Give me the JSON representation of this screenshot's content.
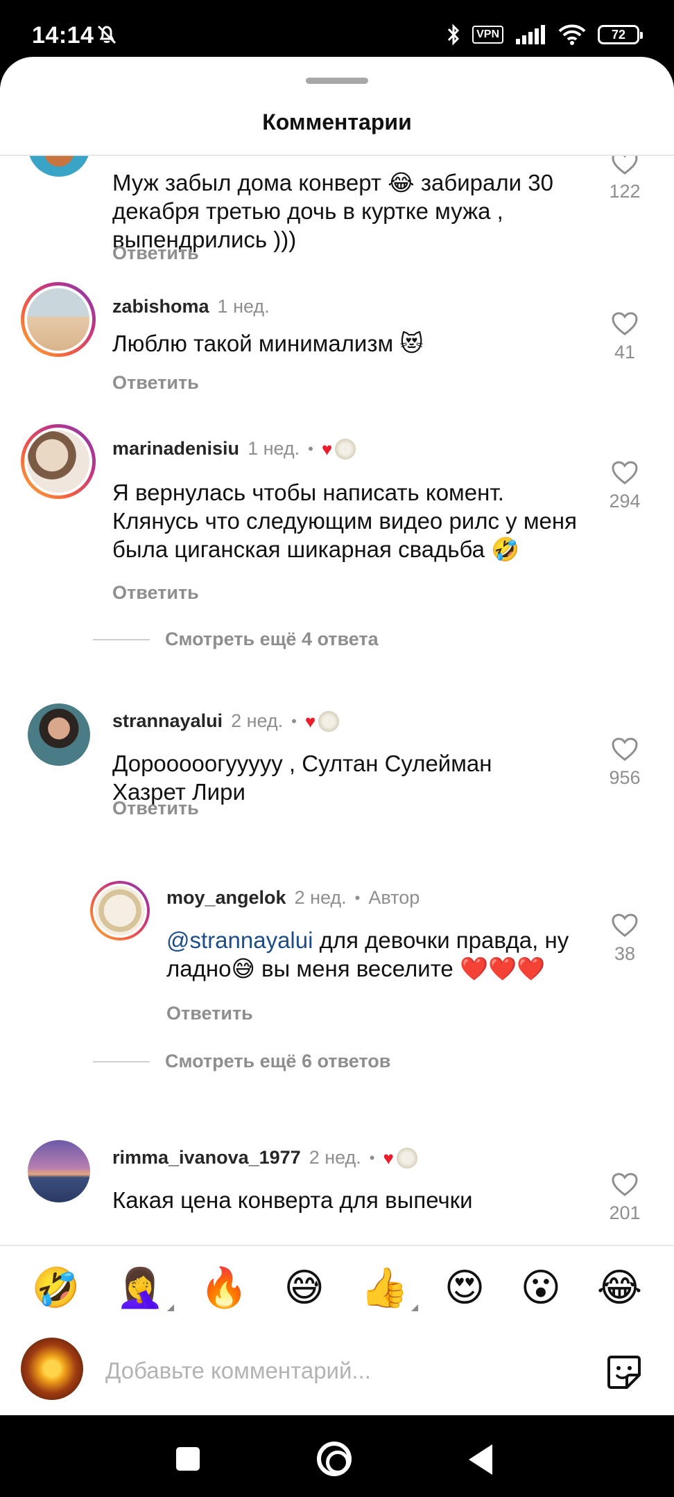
{
  "status_bar": {
    "time": "14:14",
    "vpn": "VPN",
    "battery": "72"
  },
  "sheet": {
    "title": "Комментарии"
  },
  "comments": [
    {
      "username": "",
      "text": "Муж забыл дома конверт 😂 забирали 30 декабря третью дочь в куртке мужа , выпендрились )))",
      "reply_label": "Ответить",
      "likes": "122"
    },
    {
      "username": "zabishoma",
      "time": "1 нед.",
      "text": "Люблю такой минимализм 😻",
      "reply_label": "Ответить",
      "likes": "41"
    },
    {
      "username": "marinadenisiu",
      "time": "1 нед.",
      "dot": "•",
      "text": "Я вернулась чтобы написать комент. Клянусь что следующим видео рилс у меня была циганская шикарная свадьба 🤣",
      "reply_label": "Ответить",
      "likes": "294",
      "view_more": "Смотреть ещё 4 ответа"
    },
    {
      "username": "strannayalui",
      "time": "2 нед.",
      "dot": "•",
      "text": "Дорооооогууууу , Султан Сулейман Хазрет Лири",
      "reply_label": "Ответить",
      "likes": "956"
    },
    {
      "username": "moy_angelok",
      "time": "2 нед.",
      "dot": "•",
      "author_label": "Автор",
      "mention": "@strannayalui",
      "text": " для девочки правда, ну ладно😅 вы меня веселите ❤️❤️❤️",
      "reply_label": "Ответить",
      "likes": "38",
      "view_more": "Смотреть ещё 6 ответов"
    },
    {
      "username": "rimma_ivanova_1977",
      "time": "2 нед.",
      "dot": "•",
      "text": "Какая цена конверта для выпечки",
      "likes": "201"
    }
  ],
  "emoji_bar": [
    "🤣",
    "🤦‍♀️",
    "🔥",
    "😅",
    "👍",
    "😍",
    "😮",
    "😂"
  ],
  "input": {
    "placeholder": "Добавьте комментарий..."
  },
  "icons": {
    "like": "heart-outline-icon",
    "sticker": "sticker-icon",
    "author_liked": "red-heart-icon"
  },
  "colors": {
    "accent_red": "#ed1c2b",
    "mention_blue": "#1d4e89",
    "muted_gray": "#8e8e8e"
  }
}
